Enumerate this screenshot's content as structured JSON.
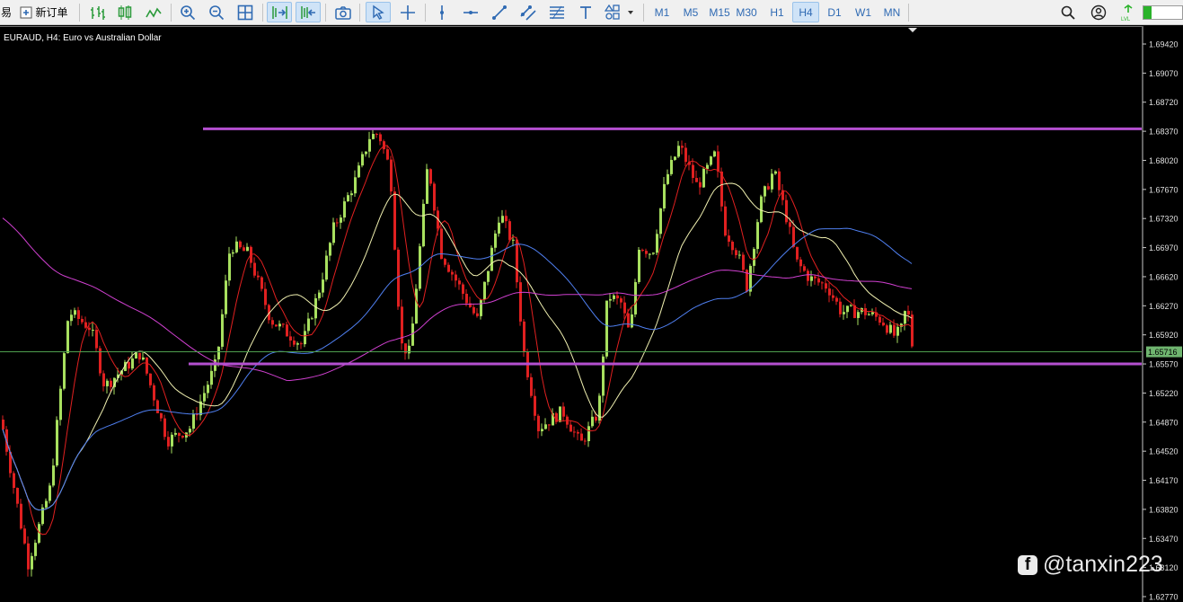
{
  "toolbar": {
    "cut_label": "易",
    "new_order_label": "新订单",
    "timeframes": [
      "M1",
      "M5",
      "M15",
      "M30",
      "H1",
      "H4",
      "D1",
      "W1",
      "MN"
    ],
    "active_timeframe": "H4"
  },
  "chart": {
    "title": "EURAUD, H4:  Euro vs Australian Dollar",
    "current_price": "1.65716",
    "price_labels": [
      "1.69420",
      "1.69070",
      "1.68720",
      "1.68370",
      "1.68020",
      "1.67670",
      "1.67320",
      "1.66970",
      "1.66620",
      "1.66270",
      "1.65920",
      "1.65570",
      "1.65220",
      "1.64870",
      "1.64520",
      "1.64170",
      "1.63820",
      "1.63470",
      "1.63120",
      "1.62770"
    ],
    "colors": {
      "background": "#000000",
      "bull_candle": "#a8e05f",
      "bear_candle": "#e02020",
      "resistance_line": "#b44fd0",
      "ma_fast": "#e02020",
      "ma_mid": "#f0f0b0",
      "ma_slow": "#4f7ff0",
      "ma_long": "#d040d0",
      "price_line": "#4f9f4f"
    },
    "levels": {
      "resistance": 1.684,
      "support": 1.6557
    }
  },
  "watermark": {
    "icon": "facebook-icon",
    "handle": "@tanxin223"
  }
}
